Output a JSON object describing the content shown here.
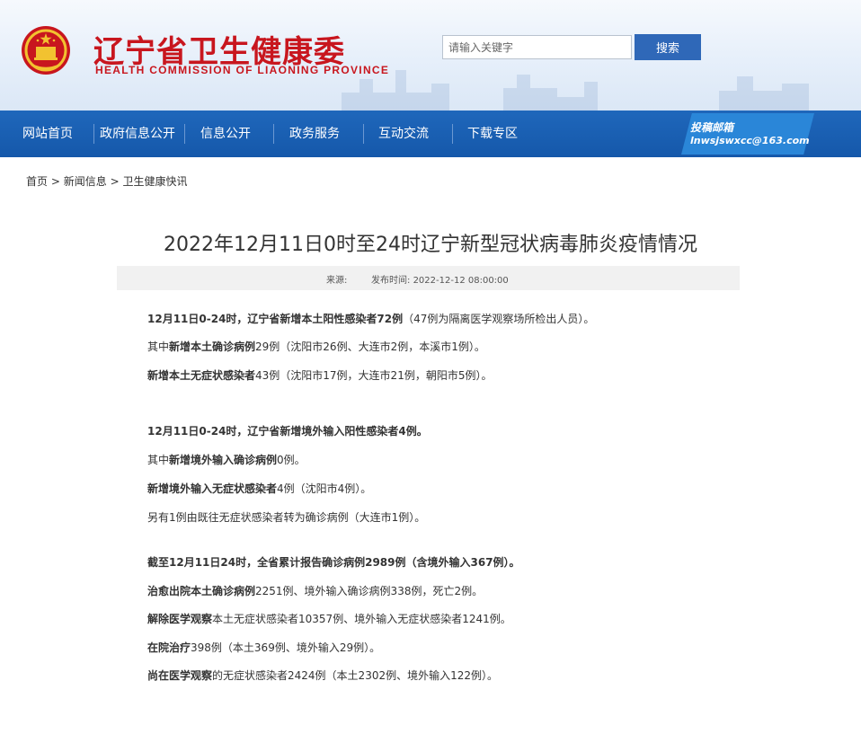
{
  "site": {
    "name_cn": "辽宁省卫生健康委",
    "name_en": "HEALTH COMMISSION OF LIAONING PROVINCE",
    "brand_color": "#c8161e"
  },
  "search": {
    "placeholder": "请输入关键字",
    "button_label": "搜索"
  },
  "nav": {
    "items": [
      "网站首页",
      "政府信息公开",
      "信息公开",
      "政务服务",
      "互动交流",
      "下载专区"
    ],
    "mail_title": "投稿邮箱",
    "mail_address": "lnwsjswxcc@163.com",
    "color": "#1a5fb4"
  },
  "breadcrumb": {
    "items": [
      "首页",
      "新闻信息",
      "卫生健康快讯"
    ],
    "separator": ">"
  },
  "article": {
    "title": "2022年12月11日0时至24时辽宁新型冠状病毒肺炎疫情情况",
    "source_label": "来源:",
    "date_label": "发布时间:",
    "date_value": "2022-12-12 08:00:00",
    "paragraphs": [
      [
        {
          "b": "12月11日0-24时，辽宁省新增本土阳性感染者72例"
        },
        {
          "t": "（47例为隔离医学观察场所检出人员）。"
        }
      ],
      [
        {
          "t": "其中"
        },
        {
          "b": "新增本土确诊病例"
        },
        {
          "t": "29例（沈阳市26例、大连市2例，本溪市1例）。"
        }
      ],
      [
        {
          "b": "新增本土无症状感染者"
        },
        {
          "t": "43例（沈阳市17例，大连市21例，朝阳市5例）。"
        }
      ],
      [
        {
          "b": "12月11日0-24时，辽宁省新增境外输入阳性感染者4例。"
        }
      ],
      [
        {
          "t": "其中"
        },
        {
          "b": "新增境外输入确诊病例"
        },
        {
          "t": "0例。"
        }
      ],
      [
        {
          "b": "新增境外输入无症状感染者"
        },
        {
          "t": "4例（沈阳市4例）。"
        }
      ],
      [
        {
          "t": "另有1例由既往无症状感染者转为确诊病例（大连市1例）。"
        }
      ],
      [
        {
          "b": "截至12月11日24时，全省累计报告确诊病例2989例（含境外输入367例）。"
        }
      ],
      [
        {
          "b": "治愈出院本土确诊病例"
        },
        {
          "t": "2251例、境外输入确诊病例338例，死亡2例。"
        }
      ],
      [
        {
          "b": "解除医学观察"
        },
        {
          "t": "本土无症状感染者10357例、境外输入无症状感染者1241例。"
        }
      ],
      [
        {
          "b": "在院治疗"
        },
        {
          "t": "398例（本土369例、境外输入29例）。"
        }
      ],
      [
        {
          "b": "尚在医学观察"
        },
        {
          "t": "的无症状感染者2424例（本土2302例、境外输入122例）。"
        }
      ]
    ]
  }
}
